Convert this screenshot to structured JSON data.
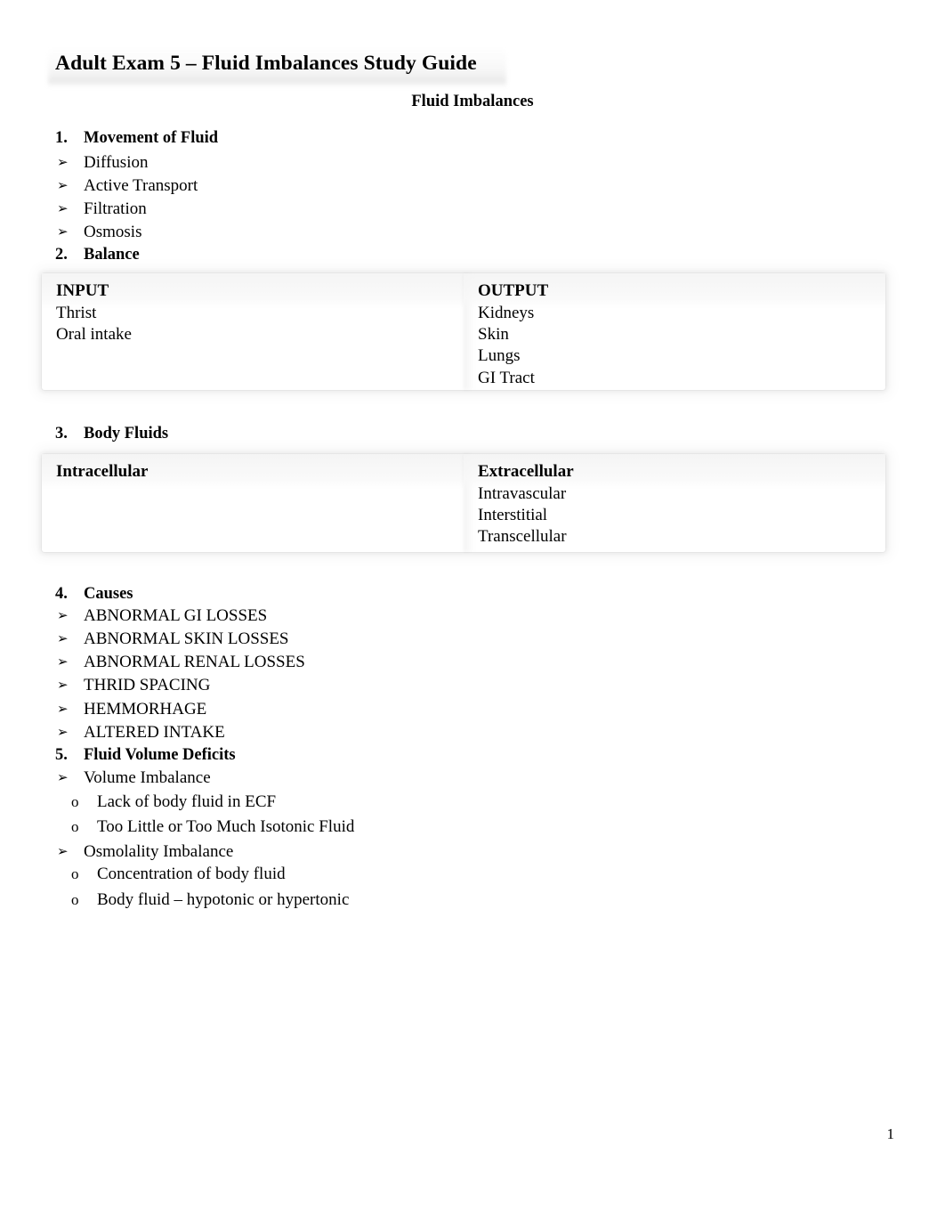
{
  "document": {
    "title": "Adult Exam 5 – Fluid Imbalances Study Guide",
    "subtitle": "Fluid Imbalances",
    "page_number": "1"
  },
  "markers": {
    "arrow_bullet": "➢",
    "circle_bullet": "o"
  },
  "sections": [
    {
      "number": "1.",
      "heading": "Movement of Fluid",
      "bullets": [
        "Diffusion",
        "Active Transport",
        "Filtration",
        "Osmosis"
      ]
    },
    {
      "number": "2.",
      "heading": "Balance"
    },
    {
      "number": "3.",
      "heading": "Body Fluids"
    },
    {
      "number": "4.",
      "heading": "Causes",
      "bullets": [
        "ABNORMAL GI LOSSES",
        "ABNORMAL SKIN LOSSES",
        "ABNORMAL RENAL LOSSES",
        "THRID SPACING",
        "HEMMORHAGE",
        "ALTERED INTAKE"
      ]
    },
    {
      "number": "5.",
      "heading": "Fluid Volume Deficits",
      "bullets": [
        {
          "label": "Volume Imbalance",
          "subitems": [
            "Lack of body fluid in ECF",
            "Too Little or Too Much Isotonic Fluid"
          ]
        },
        {
          "label": "Osmolality Imbalance",
          "subitems": [
            "Concentration of body fluid",
            "Body fluid – hypotonic or hypertonic"
          ]
        }
      ]
    }
  ],
  "balance_table": {
    "columns": [
      {
        "header": "INPUT",
        "items": [
          "Thrist",
          "Oral intake"
        ]
      },
      {
        "header": "OUTPUT",
        "items": [
          "Kidneys",
          "Skin",
          "Lungs",
          "GI Tract"
        ]
      }
    ]
  },
  "body_fluids_table": {
    "columns": [
      {
        "header": "Intracellular",
        "items": []
      },
      {
        "header": "Extracellular",
        "items": [
          "Intravascular",
          "Interstitial",
          "Transcellular"
        ]
      }
    ]
  }
}
